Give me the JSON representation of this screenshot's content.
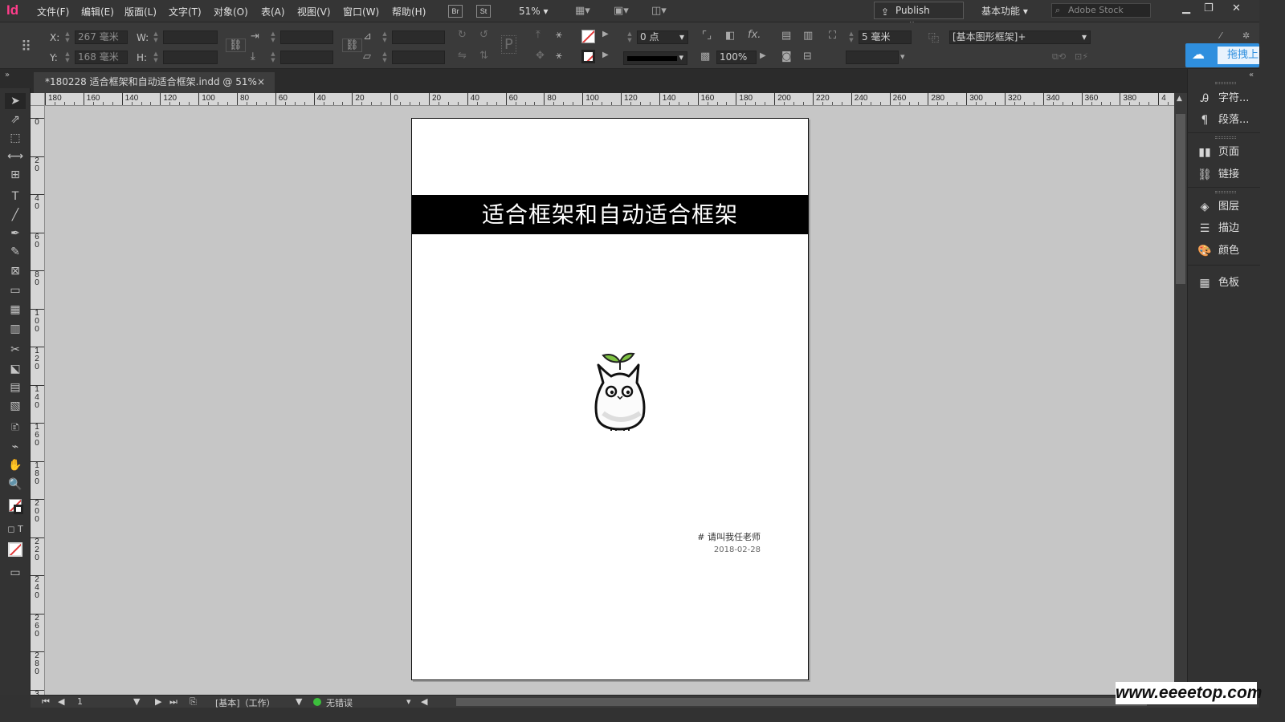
{
  "app": {
    "logo": "Id",
    "menus": [
      "文件(F)",
      "编辑(E)",
      "版面(L)",
      "文字(T)",
      "对象(O)",
      "表(A)",
      "视图(V)",
      "窗口(W)",
      "帮助(H)"
    ],
    "bridge_label": "Br",
    "stock_label": "St",
    "zoom": "51%",
    "publish_label": "Publish Online",
    "workspace": "基本功能",
    "search_placeholder": "Adobe Stock",
    "cloud_label": "拖拽上"
  },
  "control": {
    "x_label": "X:",
    "x_value": "267 毫米",
    "y_label": "Y:",
    "y_value": "168 毫米",
    "w_label": "W:",
    "h_label": "H:",
    "stroke_weight": "0 点",
    "opacity": "100%",
    "offset": "5 毫米",
    "object_style": "[基本图形框架]+"
  },
  "document": {
    "tab_title": "*180228 适合框架和自动适合框架.indd @ 51%",
    "banner_title": "适合框架和自动适合框架",
    "credit_line": "# 请叫我任老师",
    "credit_date": "2018-02-28"
  },
  "ruler": {
    "h_labels": [
      "180",
      "160",
      "140",
      "120",
      "100",
      "80",
      "60",
      "40",
      "20",
      "0",
      "20",
      "40",
      "60",
      "80",
      "100",
      "120",
      "140",
      "160",
      "180",
      "200",
      "220",
      "240",
      "260",
      "280",
      "300",
      "320",
      "340",
      "360",
      "380",
      "4"
    ],
    "v_labels": [
      "0",
      "20",
      "40",
      "60",
      "80",
      "100",
      "120",
      "140",
      "160",
      "180",
      "200",
      "220",
      "240",
      "260",
      "280",
      "3"
    ]
  },
  "panels": [
    {
      "label": "字符...",
      "icon": "character-icon"
    },
    {
      "label": "段落...",
      "icon": "paragraph-icon"
    },
    {
      "label": "页面",
      "icon": "pages-icon"
    },
    {
      "label": "链接",
      "icon": "links-icon"
    },
    {
      "label": "图层",
      "icon": "layers-icon"
    },
    {
      "label": "描边",
      "icon": "stroke-icon"
    },
    {
      "label": "颜色",
      "icon": "color-icon"
    },
    {
      "label": "色板",
      "icon": "swatches-icon"
    }
  ],
  "status": {
    "page_number": "1",
    "master": "[基本]（工作）",
    "preflight": "无错误"
  },
  "watermark": "www.eeeetop.com",
  "colors": {
    "accent_logo": "#ff3d8b",
    "cloud_blue": "#2f8fde",
    "preflight_ok": "#3cbf3c"
  }
}
